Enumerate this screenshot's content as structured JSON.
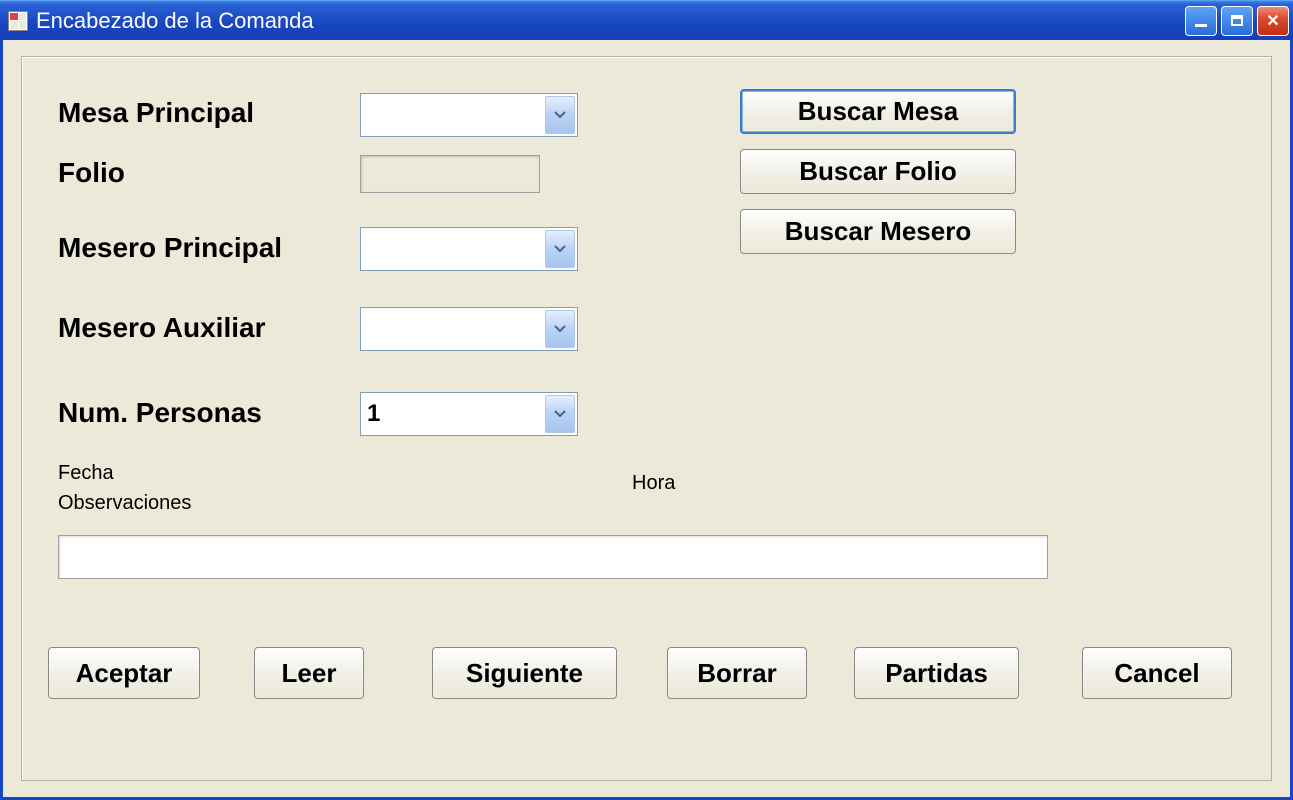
{
  "window": {
    "title": "Encabezado de la Comanda"
  },
  "labels": {
    "mesa_principal": "Mesa Principal",
    "folio": "Folio",
    "mesero_principal": "Mesero Principal",
    "mesero_auxiliar": "Mesero Auxiliar",
    "num_personas": "Num. Personas",
    "fecha": "Fecha",
    "hora": "Hora",
    "observaciones": "Observaciones"
  },
  "fields": {
    "mesa_principal": "",
    "folio": "",
    "mesero_principal": "",
    "mesero_auxiliar": "",
    "num_personas": "1",
    "observaciones": ""
  },
  "buttons": {
    "buscar_mesa": "Buscar Mesa",
    "buscar_folio": "Buscar Folio",
    "buscar_mesero": "Buscar Mesero",
    "aceptar": "Aceptar",
    "leer": "Leer",
    "siguiente": "Siguiente",
    "borrar": "Borrar",
    "partidas": "Partidas",
    "cancel": "Cancel"
  }
}
